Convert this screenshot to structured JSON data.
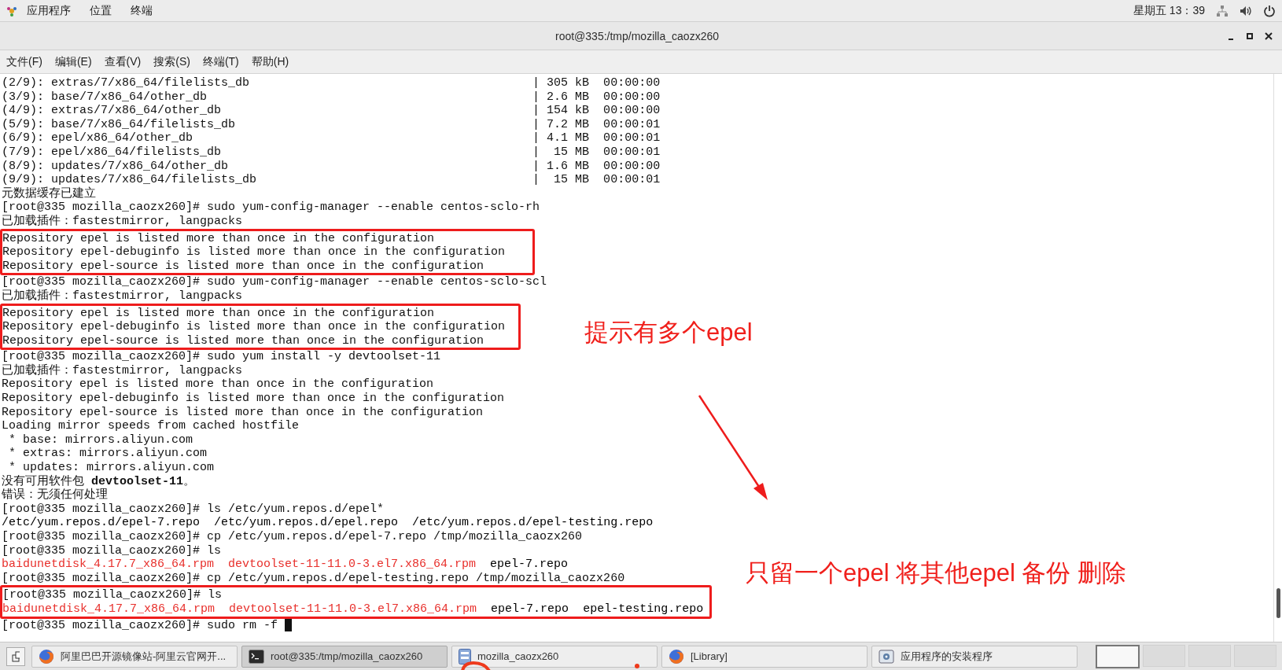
{
  "top_bar": {
    "menus": [
      "应用程序",
      "位置",
      "终端"
    ],
    "clock": "星期五 13：39"
  },
  "window": {
    "title": "root@335:/tmp/mozilla_caozx260"
  },
  "menu_bar": [
    "文件(F)",
    "编辑(E)",
    "查看(V)",
    "搜索(S)",
    "终端(T)",
    "帮助(H)"
  ],
  "terminal": {
    "lines": [
      {
        "kind": "download",
        "file": "(2/9): extras/7/x86_64/filelists_db",
        "stats": "| 305 kB  00:00:00"
      },
      {
        "kind": "download",
        "file": "(3/9): base/7/x86_64/other_db",
        "stats": "| 2.6 MB  00:00:00"
      },
      {
        "kind": "download",
        "file": "(4/9): extras/7/x86_64/other_db",
        "stats": "| 154 kB  00:00:00"
      },
      {
        "kind": "download",
        "file": "(5/9): base/7/x86_64/filelists_db",
        "stats": "| 7.2 MB  00:00:01"
      },
      {
        "kind": "download",
        "file": "(6/9): epel/x86_64/other_db",
        "stats": "| 4.1 MB  00:00:01"
      },
      {
        "kind": "download",
        "file": "(7/9): epel/x86_64/filelists_db",
        "stats": "|  15 MB  00:00:01"
      },
      {
        "kind": "download",
        "file": "(8/9): updates/7/x86_64/other_db",
        "stats": "| 1.6 MB  00:00:00"
      },
      {
        "kind": "download",
        "file": "(9/9): updates/7/x86_64/filelists_db",
        "stats": "|  15 MB  00:00:01"
      },
      {
        "kind": "plain",
        "text": "元数据缓存已建立"
      },
      {
        "kind": "plain",
        "text": "[root@335 mozilla_caozx260]# sudo yum-config-manager --enable centos-sclo-rh"
      },
      {
        "kind": "plain",
        "text": "已加载插件：fastestmirror, langpacks"
      },
      {
        "kind": "plain",
        "text": "Repository epel is listed more than once in the configuration"
      },
      {
        "kind": "plain",
        "text": "Repository epel-debuginfo is listed more than once in the configuration"
      },
      {
        "kind": "plain",
        "text": "Repository epel-source is listed more than once in the configuration"
      },
      {
        "kind": "plain",
        "text": "[root@335 mozilla_caozx260]# sudo yum-config-manager --enable centos-sclo-scl"
      },
      {
        "kind": "plain",
        "text": "已加载插件：fastestmirror, langpacks"
      },
      {
        "kind": "plain",
        "text": "Repository epel is listed more than once in the configuration"
      },
      {
        "kind": "plain",
        "text": "Repository epel-debuginfo is listed more than once in the configuration"
      },
      {
        "kind": "plain",
        "text": "Repository epel-source is listed more than once in the configuration"
      },
      {
        "kind": "plain",
        "text": "[root@335 mozilla_caozx260]# sudo yum install -y devtoolset-11"
      },
      {
        "kind": "plain",
        "text": "已加载插件：fastestmirror, langpacks"
      },
      {
        "kind": "plain",
        "text": "Repository epel is listed more than once in the configuration"
      },
      {
        "kind": "plain",
        "text": "Repository epel-debuginfo is listed more than once in the configuration"
      },
      {
        "kind": "plain",
        "text": "Repository epel-source is listed more than once in the configuration"
      },
      {
        "kind": "plain",
        "text": "Loading mirror speeds from cached hostfile"
      },
      {
        "kind": "plain",
        "text": " * base: mirrors.aliyun.com"
      },
      {
        "kind": "plain",
        "text": " * extras: mirrors.aliyun.com"
      },
      {
        "kind": "plain",
        "text": " * updates: mirrors.aliyun.com"
      },
      {
        "kind": "rich",
        "text": "没有可用软件包 **devtoolset-11**。"
      },
      {
        "kind": "plain",
        "text": "错误：无须任何处理"
      },
      {
        "kind": "plain",
        "text": "[root@335 mozilla_caozx260]# ls /etc/yum.repos.d/epel*"
      },
      {
        "kind": "segments",
        "segments": [
          {
            "text": "/etc/yum.repos.d/epel-7.repo",
            "color": "#000000"
          },
          {
            "text": "/etc/yum.repos.d/epel.repo",
            "color": "#000000"
          },
          {
            "text": "/etc/yum.repos.d/epel-testing.repo",
            "color": "#000000"
          }
        ]
      },
      {
        "kind": "plain",
        "text": "[root@335 mozilla_caozx260]# cp /etc/yum.repos.d/epel-7.repo /tmp/mozilla_caozx260"
      },
      {
        "kind": "plain",
        "text": "[root@335 mozilla_caozx260]# ls"
      },
      {
        "kind": "segments",
        "segments": [
          {
            "text": "baidunetdisk_4.17.7_x86_64.rpm",
            "color": "#e8302c"
          },
          {
            "text": "devtoolset-11-11.0-3.el7.x86_64.rpm",
            "color": "#e8302c"
          },
          {
            "text": "epel-7.repo",
            "color": "#000000"
          }
        ]
      },
      {
        "kind": "plain",
        "text": "[root@335 mozilla_caozx260]# cp /etc/yum.repos.d/epel-testing.repo /tmp/mozilla_caozx260"
      },
      {
        "kind": "plain",
        "text": "[root@335 mozilla_caozx260]# ls"
      },
      {
        "kind": "segments",
        "segments": [
          {
            "text": "baidunetdisk_4.17.7_x86_64.rpm",
            "color": "#e8302c"
          },
          {
            "text": "devtoolset-11-11.0-3.el7.x86_64.rpm",
            "color": "#e8302c"
          },
          {
            "text": "epel-7.repo",
            "color": "#000000"
          },
          {
            "text": "epel-testing.repo",
            "color": "#000000"
          }
        ]
      },
      {
        "kind": "input",
        "text": "[root@335 mozilla_caozx260]# sudo rm -f"
      }
    ]
  },
  "annotations": [
    {
      "text": "提示有多个epel"
    },
    {
      "text": "只留一个epel 将其他epel 备份 删除"
    }
  ],
  "taskbar": {
    "items": [
      {
        "kind": "browser",
        "label": "阿里巴巴开源镜像站-阿里云官网开...",
        "selected": false
      },
      {
        "kind": "terminal",
        "label": "root@335:/tmp/mozilla_caozx260",
        "selected": true
      },
      {
        "kind": "files",
        "label": "mozilla_caozx260",
        "selected": false
      },
      {
        "kind": "browser",
        "label": "[Library]",
        "selected": false
      },
      {
        "kind": "installer",
        "label": "应用程序的安装程序",
        "selected": false
      }
    ],
    "workspaces": [
      {
        "selected": true
      },
      {
        "selected": false
      },
      {
        "selected": false
      },
      {
        "selected": false
      }
    ]
  }
}
